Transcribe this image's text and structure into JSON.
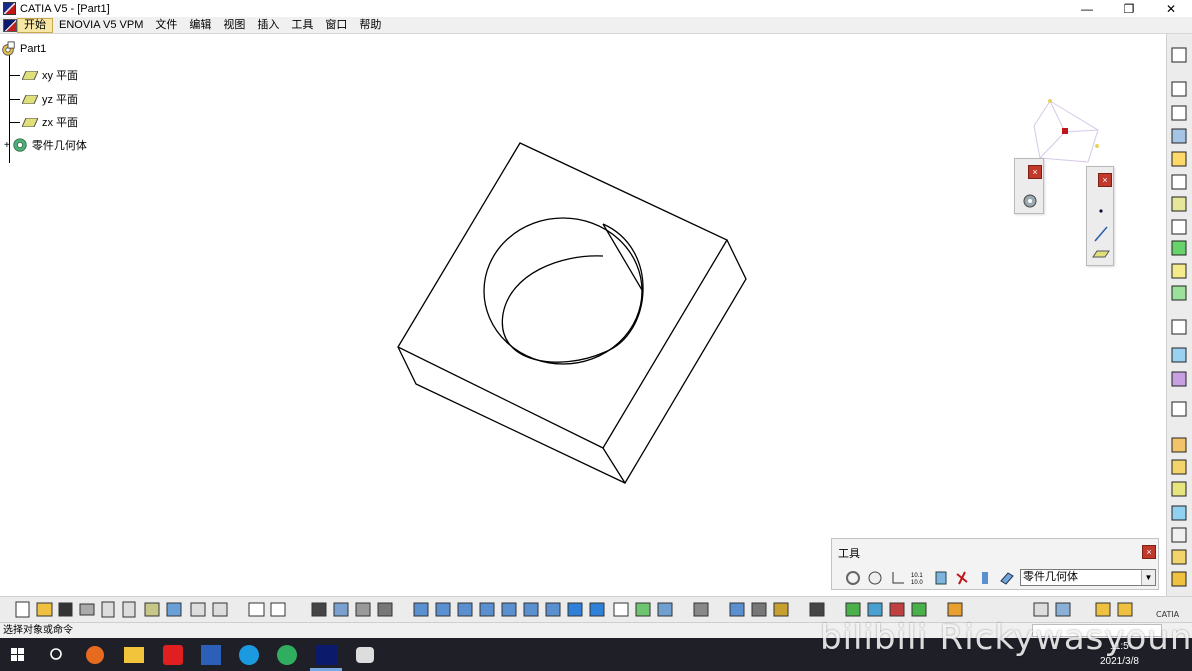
{
  "window": {
    "title": "CATIA V5 - [Part1]",
    "minimize": "—",
    "maximize": "❐",
    "close": "✕"
  },
  "menu": {
    "items": [
      "开始",
      "ENOVIA V5 VPM",
      "文件",
      "编辑",
      "视图",
      "插入",
      "工具",
      "窗口",
      "帮助"
    ]
  },
  "tree": {
    "root": "Part1",
    "children": [
      "xy 平面",
      "yz 平面",
      "zx 平面",
      "零件几何体"
    ]
  },
  "tools_panel": {
    "title": "工具",
    "close": "×",
    "selected_body": "零件几何体"
  },
  "floating": {
    "left_close": "×",
    "right_close": "×"
  },
  "status": {
    "text": "选择对象或命令"
  },
  "taskbar": {
    "time": "11:5",
    "date": "2021/3/8"
  },
  "watermark": "bilibili Rickywasyoung",
  "colors": {
    "accent_red": "#c0392b",
    "menu_active": "#f6e7a4",
    "taskbar": "#1f1f28"
  }
}
